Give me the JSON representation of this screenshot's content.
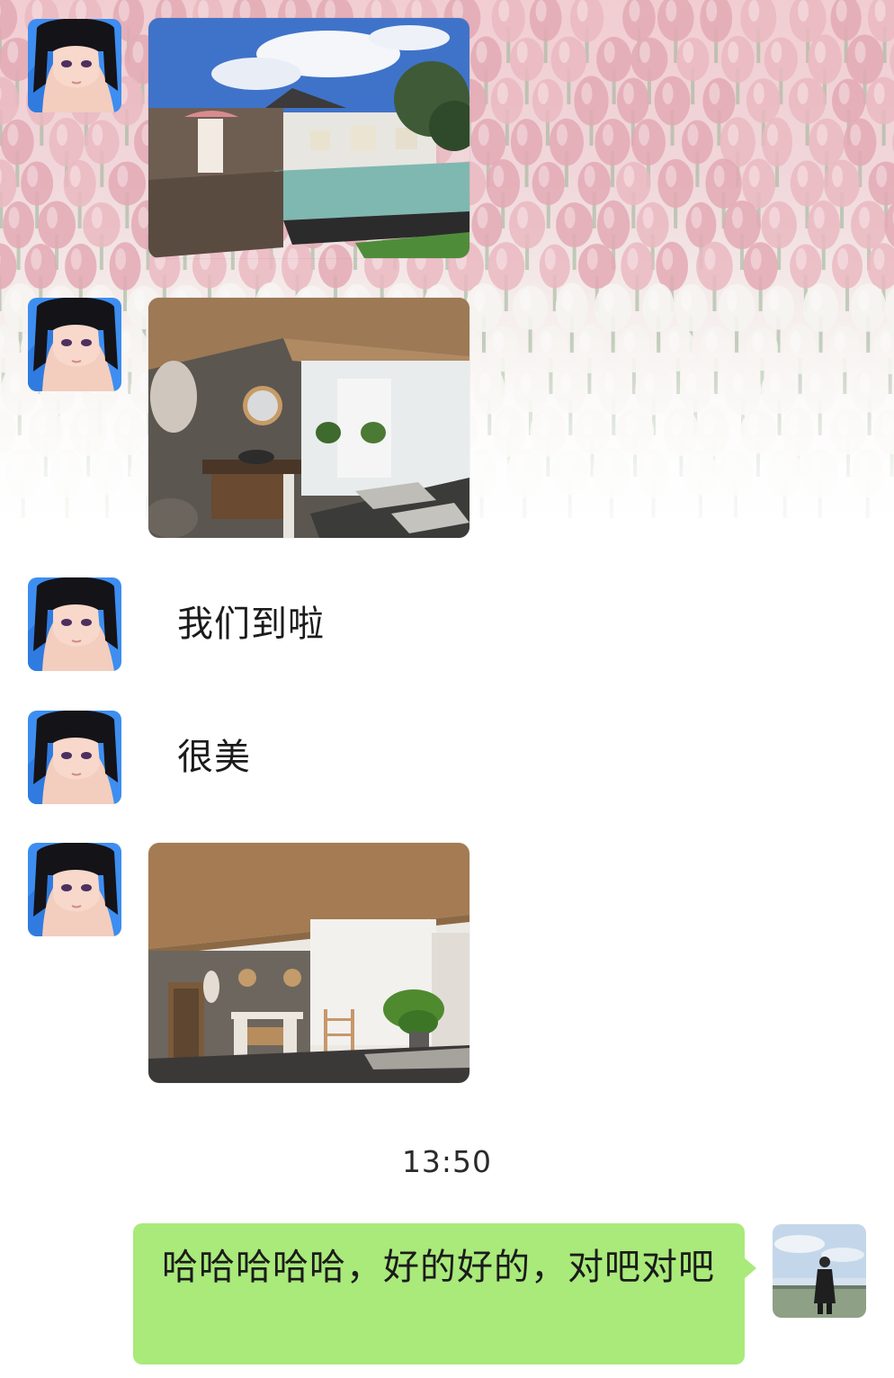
{
  "chat": {
    "messages": [
      {
        "id": "m1",
        "sender": "contact",
        "type": "image",
        "image_subject": "villa-pool-photo"
      },
      {
        "id": "m2",
        "sender": "contact",
        "type": "image",
        "image_subject": "bathroom-mirror-photo"
      },
      {
        "id": "m3",
        "sender": "contact",
        "type": "text",
        "text": "我们到啦"
      },
      {
        "id": "m4",
        "sender": "contact",
        "type": "text",
        "text": "很美"
      },
      {
        "id": "m5",
        "sender": "contact",
        "type": "image",
        "image_subject": "open-bathroom-photo"
      },
      {
        "id": "m6",
        "sender": "me",
        "type": "text",
        "text": "哈哈哈哈哈，好的好的，对吧对吧"
      }
    ],
    "timestamp": "13:50"
  },
  "theme": {
    "outgoing_bubble_color": "#a9ea7a",
    "wallpaper": "tulip-field-wallpaper",
    "contact_avatar_icon": "anime-girl-avatar-icon",
    "self_avatar_icon": "person-in-field-avatar-icon"
  }
}
